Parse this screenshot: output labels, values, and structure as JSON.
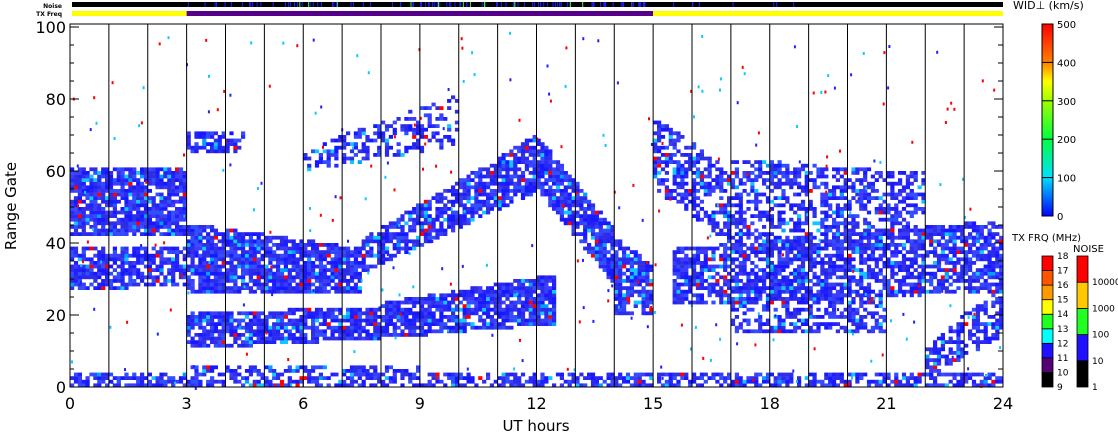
{
  "chart_data": {
    "type": "heatmap",
    "title": "",
    "xlabel": "UT hours",
    "ylabel": "Range Gate",
    "xlim": [
      0,
      24
    ],
    "ylim": [
      0,
      100
    ],
    "xticks": [
      "0",
      "3",
      "6",
      "9",
      "12",
      "15",
      "18",
      "21",
      "24"
    ],
    "yticks": [
      "0",
      "20",
      "40",
      "60",
      "80",
      "100"
    ],
    "top_bars": {
      "noise_label": "Noise",
      "txfreq_label": "TX Freq",
      "txfreq_segments": [
        {
          "start": 0,
          "end": 3,
          "color": "#ffff00"
        },
        {
          "start": 3,
          "end": 15,
          "color": "#550088"
        },
        {
          "start": 15,
          "end": 24,
          "color": "#ffff00"
        }
      ]
    },
    "width_colorbar": {
      "label": "WID⊥ (km/s)",
      "ticks": [
        "0",
        "100",
        "200",
        "300",
        "400",
        "500"
      ],
      "range": [
        0,
        500
      ]
    },
    "txfreq_colorbar": {
      "label": "TX FRQ (MHz)",
      "ticks": [
        "9",
        "10",
        "11",
        "12",
        "13",
        "14",
        "15",
        "16",
        "17",
        "18"
      ],
      "colors": [
        "#000000",
        "#550077",
        "#2010ff",
        "#00ffff",
        "#20ff20",
        "#ffff00",
        "#ff9900",
        "#ff5500",
        "#ff0000"
      ]
    },
    "noise_colorbar": {
      "label": "NOISE",
      "ticks": [
        "1",
        "10",
        "100",
        "1000",
        "10000"
      ],
      "colors": [
        "#000000",
        "#2010ff",
        "#20ff20",
        "#ffc800",
        "#ff0000"
      ]
    },
    "bands": [
      {
        "t0": 0,
        "t1": 3,
        "g0a": 42,
        "g1a": 60,
        "g0b": 42,
        "g1b": 60,
        "density": 0.85
      },
      {
        "t0": 0,
        "t1": 3,
        "g0a": 27,
        "g1a": 38,
        "g0b": 29,
        "g1b": 38,
        "density": 0.75
      },
      {
        "t0": 0,
        "t1": 3,
        "g0a": 0,
        "g1a": 2,
        "g0b": 0,
        "g1b": 3,
        "density": 0.7
      },
      {
        "t0": 3,
        "t1": 7.5,
        "g0a": 27,
        "g1a": 44,
        "g0b": 26,
        "g1b": 37,
        "density": 0.85
      },
      {
        "t0": 3,
        "t1": 8,
        "g0a": 11,
        "g1a": 19,
        "g0b": 14,
        "g1b": 21,
        "density": 0.8
      },
      {
        "t0": 3,
        "t1": 9,
        "g0a": 0,
        "g1a": 5,
        "g0b": 0,
        "g1b": 5,
        "density": 0.6
      },
      {
        "t0": 3,
        "t1": 4.5,
        "g0a": 65,
        "g1a": 70,
        "g0b": 66,
        "g1b": 70,
        "density": 0.5
      },
      {
        "t0": 6,
        "t1": 10,
        "g0a": 60,
        "g1a": 65,
        "g0b": 68,
        "g1b": 80,
        "density": 0.4
      },
      {
        "t0": 7.5,
        "t1": 12,
        "g0a": 32,
        "g1a": 40,
        "g0b": 55,
        "g1b": 69,
        "density": 0.8
      },
      {
        "t0": 8,
        "t1": 12.5,
        "g0a": 14,
        "g1a": 22,
        "g0b": 18,
        "g1b": 30,
        "density": 0.85
      },
      {
        "t0": 9,
        "t1": 24,
        "g0a": 0,
        "g1a": 3,
        "g0b": 0,
        "g1b": 3,
        "density": 0.6
      },
      {
        "t0": 12,
        "t1": 14,
        "g0a": 55,
        "g1a": 68,
        "g0b": 28,
        "g1b": 42,
        "density": 0.8
      },
      {
        "t0": 14,
        "t1": 15,
        "g0a": 20,
        "g1a": 40,
        "g0b": 20,
        "g1b": 32,
        "density": 0.8
      },
      {
        "t0": 15,
        "t1": 17,
        "g0a": 55,
        "g1a": 74,
        "g0b": 40,
        "g1b": 58,
        "density": 0.6
      },
      {
        "t0": 17,
        "t1": 22,
        "g0a": 38,
        "g1a": 62,
        "g0b": 38,
        "g1b": 58,
        "density": 0.5
      },
      {
        "t0": 15.5,
        "t1": 24,
        "g0a": 23,
        "g1a": 37,
        "g0b": 27,
        "g1b": 45,
        "density": 0.7
      },
      {
        "t0": 17,
        "t1": 21,
        "g0a": 15,
        "g1a": 27,
        "g0b": 16,
        "g1b": 25,
        "density": 0.5
      },
      {
        "t0": 22,
        "t1": 24,
        "g0a": 3,
        "g1a": 10,
        "g0b": 15,
        "g1b": 28,
        "density": 0.6
      }
    ]
  }
}
